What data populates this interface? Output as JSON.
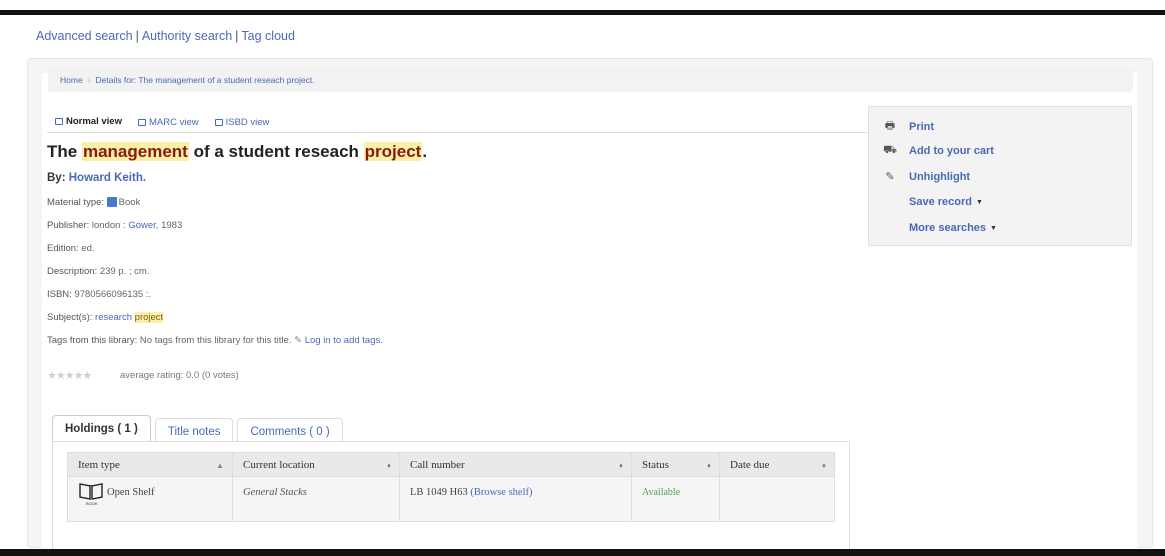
{
  "search_links": [
    "Advanced search",
    "Authority search",
    "Tag cloud"
  ],
  "breadcrumb": {
    "home": "Home",
    "current": "Details for: The management of a student reseach project."
  },
  "view_tabs": [
    {
      "label": "Normal view"
    },
    {
      "label": "MARC view"
    },
    {
      "label": "ISBD view"
    }
  ],
  "record": {
    "title_prefix": "The",
    "title_hl1": "management",
    "title_mid": "of a student reseach",
    "title_hl2": "project",
    "title_end": ".",
    "author_label": "By:",
    "author": "Howard Keith.",
    "material_label": "Material type:",
    "material": "Book",
    "publisher_label": "Publisher:",
    "publisher_place": "london :",
    "publisher_name": "Gower,",
    "publisher_year": "1983",
    "edition_label": "Edition:",
    "edition": "ed.",
    "description_label": "Description:",
    "description": "239 p. ; cm.",
    "isbn_label": "ISBN:",
    "isbn": "9780566096135 :.",
    "subjects_label": "Subject(s):",
    "subject_word1": "research",
    "subject_word2": "project",
    "tags_label": "Tags from this library:",
    "tags_text": "No tags from this library for this title.",
    "tags_login": "Log in to add tags.",
    "rating_text": "average rating: 0.0 (0 votes)",
    "stars": "★★★★★"
  },
  "holdings_tabs": [
    {
      "label": "Holdings ( 1 )"
    },
    {
      "label": "Title notes"
    },
    {
      "label": "Comments ( 0 )"
    }
  ],
  "holdings_table": {
    "headers": [
      "Item type",
      "Current location",
      "Call number",
      "Status",
      "Date due"
    ],
    "row": {
      "item_type": "Open Shelf",
      "item_icon_label": "BOOK",
      "location": "General Stacks",
      "call_number": "LB 1049 H63",
      "browse": "(Browse shelf)",
      "status": "Available",
      "date_due": ""
    }
  },
  "sidebar": [
    {
      "label": "Print",
      "icon": "print-icon"
    },
    {
      "label": "Add to your cart",
      "icon": "cart-icon"
    },
    {
      "label": "Unhighlight",
      "icon": "pencil-icon"
    },
    {
      "label": "Save record",
      "icon": ""
    },
    {
      "label": "More searches",
      "icon": ""
    }
  ],
  "colors": {
    "link": "#4a69b5",
    "highlight_bg": "#f7f0a6",
    "highlight_fg": "#8b1a10",
    "status_available": "#5a9a5a"
  }
}
